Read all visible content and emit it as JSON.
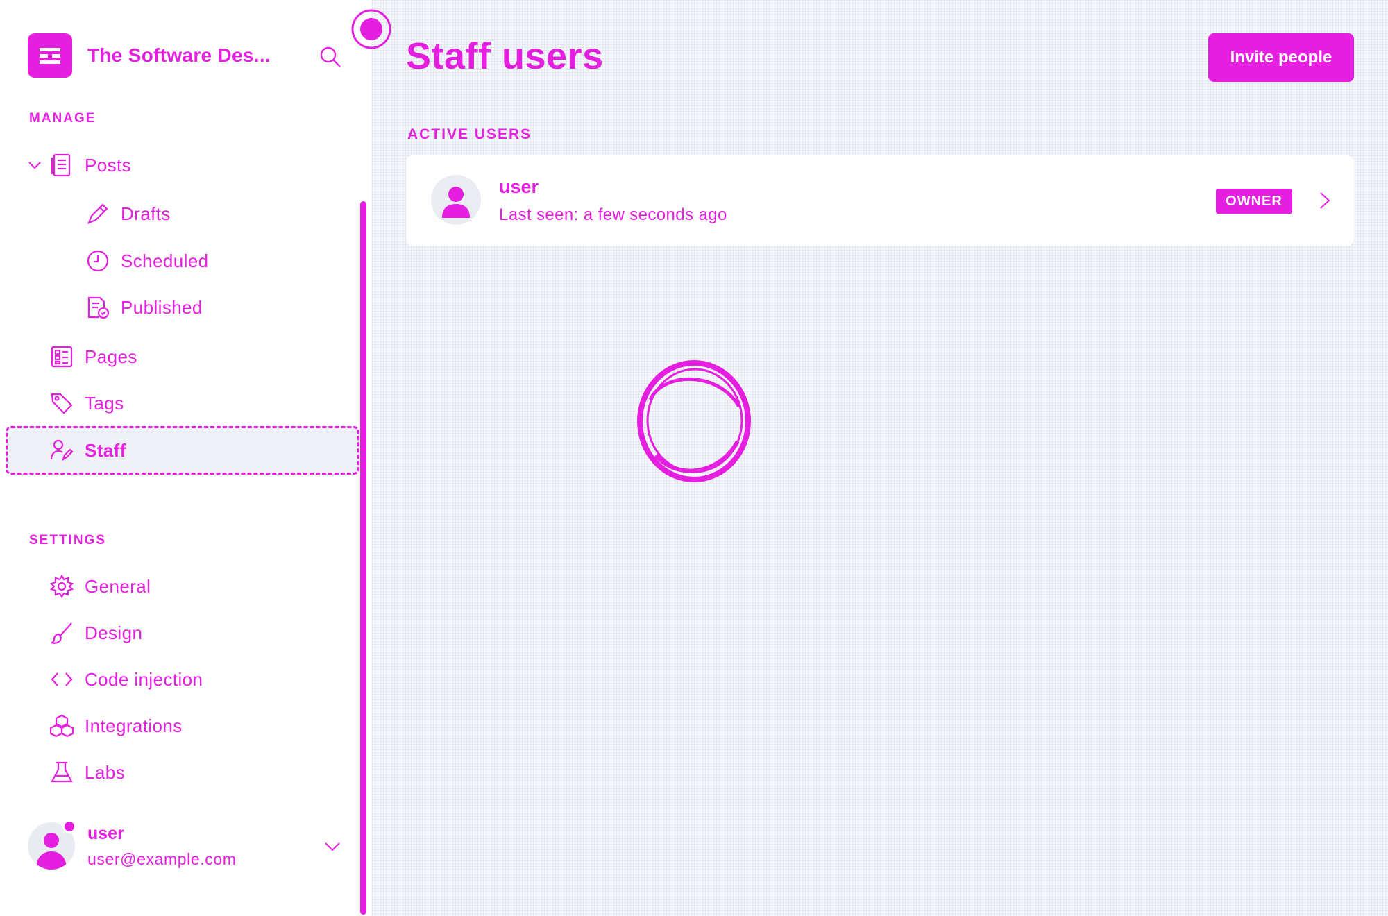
{
  "brand": {
    "name": "The Software Des..."
  },
  "sidebar": {
    "manage_label": "MANAGE",
    "settings_label": "SETTINGS",
    "manage_items": [
      {
        "label": "Posts",
        "icon": "document-icon"
      },
      {
        "label": "Drafts",
        "icon": "pencil-icon"
      },
      {
        "label": "Scheduled",
        "icon": "clock-icon"
      },
      {
        "label": "Published",
        "icon": "published-doc-icon"
      },
      {
        "label": "Pages",
        "icon": "pages-icon"
      },
      {
        "label": "Tags",
        "icon": "tag-icon"
      },
      {
        "label": "Staff",
        "icon": "staff-icon"
      }
    ],
    "settings_items": [
      {
        "label": "General",
        "icon": "gear-icon"
      },
      {
        "label": "Design",
        "icon": "brush-icon"
      },
      {
        "label": "Code injection",
        "icon": "code-icon"
      },
      {
        "label": "Integrations",
        "icon": "integrations-icon"
      },
      {
        "label": "Labs",
        "icon": "flask-icon"
      }
    ],
    "user": {
      "name": "user",
      "email": "user@example.com"
    }
  },
  "main": {
    "title": "Staff users",
    "invite_label": "Invite people",
    "list_heading": "ACTIVE USERS",
    "users": [
      {
        "name": "user",
        "last_seen": "Last seen: a few seconds ago",
        "role": "OWNER"
      }
    ]
  },
  "colors": {
    "accent": "#e41fe0",
    "background": "#f6f7fa",
    "card": "#ffffff"
  }
}
